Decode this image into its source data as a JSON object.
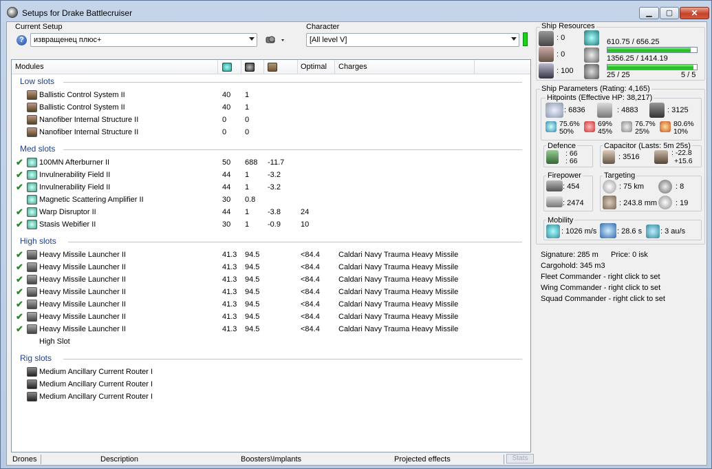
{
  "window": {
    "title": "Setups for Drake Battlecruiser"
  },
  "setup": {
    "label": "Current Setup",
    "value": "извращенец плюс+"
  },
  "character": {
    "label": "Character",
    "value": "[All level V]"
  },
  "modules": {
    "columns": {
      "modules": "Modules",
      "optimal": "Optimal",
      "charges": "Charges"
    },
    "sections": [
      {
        "title": "Low slots",
        "rows": [
          {
            "name": "Ballistic Control System II",
            "v1": "40",
            "v2": "1",
            "v3": "",
            "opt": "",
            "charges": "",
            "active": false
          },
          {
            "name": "Ballistic Control System II",
            "v1": "40",
            "v2": "1",
            "v3": "",
            "opt": "",
            "charges": "",
            "active": false
          },
          {
            "name": "Nanofiber Internal Structure II",
            "v1": "0",
            "v2": "0",
            "v3": "",
            "opt": "",
            "charges": "",
            "active": false
          },
          {
            "name": "Nanofiber Internal Structure II",
            "v1": "0",
            "v2": "0",
            "v3": "",
            "opt": "",
            "charges": "",
            "active": false
          }
        ]
      },
      {
        "title": "Med slots",
        "rows": [
          {
            "name": "100MN Afterburner II",
            "v1": "50",
            "v2": "688",
            "v3": "-11.7",
            "opt": "",
            "charges": "",
            "active": true
          },
          {
            "name": "Invulnerability Field II",
            "v1": "44",
            "v2": "1",
            "v3": "-3.2",
            "opt": "",
            "charges": "",
            "active": true
          },
          {
            "name": "Invulnerability Field II",
            "v1": "44",
            "v2": "1",
            "v3": "-3.2",
            "opt": "",
            "charges": "",
            "active": true
          },
          {
            "name": "Magnetic Scattering Amplifier II",
            "v1": "30",
            "v2": "0.8",
            "v3": "",
            "opt": "",
            "charges": "",
            "active": false
          },
          {
            "name": "Warp Disruptor II",
            "v1": "44",
            "v2": "1",
            "v3": "-3.8",
            "opt": "24",
            "charges": "",
            "active": true
          },
          {
            "name": "Stasis Webifier II",
            "v1": "30",
            "v2": "1",
            "v3": "-0.9",
            "opt": "10",
            "charges": "",
            "active": true
          }
        ]
      },
      {
        "title": "High slots",
        "rows": [
          {
            "name": "Heavy Missile Launcher II",
            "v1": "41.3",
            "v2": "94.5",
            "v3": "",
            "opt": "<84.4",
            "charges": "Caldari Navy Trauma Heavy Missile",
            "active": true
          },
          {
            "name": "Heavy Missile Launcher II",
            "v1": "41.3",
            "v2": "94.5",
            "v3": "",
            "opt": "<84.4",
            "charges": "Caldari Navy Trauma Heavy Missile",
            "active": true
          },
          {
            "name": "Heavy Missile Launcher II",
            "v1": "41.3",
            "v2": "94.5",
            "v3": "",
            "opt": "<84.4",
            "charges": "Caldari Navy Trauma Heavy Missile",
            "active": true
          },
          {
            "name": "Heavy Missile Launcher II",
            "v1": "41.3",
            "v2": "94.5",
            "v3": "",
            "opt": "<84.4",
            "charges": "Caldari Navy Trauma Heavy Missile",
            "active": true
          },
          {
            "name": "Heavy Missile Launcher II",
            "v1": "41.3",
            "v2": "94.5",
            "v3": "",
            "opt": "<84.4",
            "charges": "Caldari Navy Trauma Heavy Missile",
            "active": true
          },
          {
            "name": "Heavy Missile Launcher II",
            "v1": "41.3",
            "v2": "94.5",
            "v3": "",
            "opt": "<84.4",
            "charges": "Caldari Navy Trauma Heavy Missile",
            "active": true
          },
          {
            "name": "Heavy Missile Launcher II",
            "v1": "41.3",
            "v2": "94.5",
            "v3": "",
            "opt": "<84.4",
            "charges": "Caldari Navy Trauma Heavy Missile",
            "active": true
          },
          {
            "name": "High Slot",
            "v1": "",
            "v2": "",
            "v3": "",
            "opt": "",
            "charges": "",
            "active": false
          }
        ]
      },
      {
        "title": "Rig slots",
        "rows": [
          {
            "name": "Medium Ancillary Current Router I",
            "v1": "",
            "v2": "",
            "v3": "",
            "opt": "",
            "charges": "",
            "active": false
          },
          {
            "name": "Medium Ancillary Current Router I",
            "v1": "",
            "v2": "",
            "v3": "",
            "opt": "",
            "charges": "",
            "active": false
          },
          {
            "name": "Medium Ancillary Current Router I",
            "v1": "",
            "v2": "",
            "v3": "",
            "opt": "",
            "charges": "",
            "active": false
          }
        ]
      }
    ]
  },
  "bottom_tabs": [
    "Drones",
    "Description",
    "Boosters\\Implants",
    "Projected effects"
  ],
  "stats_button": "Stats",
  "resources": {
    "title": "Ship Resources",
    "turrets": ": 0",
    "launchers": ": 0",
    "calibration": ": 100",
    "cpu": "610.75 / 656.25",
    "cpu_fraction": 0.93,
    "power": "1356.25 / 1414.19",
    "power_fraction": 0.96,
    "drones": "25 / 25",
    "drones_active": "5 / 5"
  },
  "params": {
    "title": "Ship Parameters (Rating: 4,165)",
    "hitpoints": "Hitpoints (Effective HP: 38,217)",
    "shield_hp": ": 6836",
    "armor_hp": ": 4883",
    "hull_hp": ": 3125",
    "res": [
      [
        "75.6%",
        "50%"
      ],
      [
        "69%",
        "45%"
      ],
      [
        "76.7%",
        "25%"
      ],
      [
        "80.6%",
        "10%"
      ]
    ],
    "defence": "Defence",
    "def1": ": 66",
    "def2": ": 66",
    "capacitor": "Capacitor (Lasts: 5m 25s)",
    "cap_amount": ": 3516",
    "cap_d1": ": -22.8",
    "cap_d2": "+15.6",
    "firepower": "Firepower",
    "volley": ": 454",
    "dps": ": 2474",
    "targeting": "Targeting",
    "range": ": 75 km",
    "max_targets": ": 8",
    "scan_res": ": 243.8 mm",
    "sensor": ": 19",
    "mobility": "Mobility",
    "speed": ": 1026 m/s",
    "align": ": 28.6 s",
    "warp": ": 3 au/s",
    "signature": "Signature: 285 m",
    "price": "Price: 0 isk",
    "cargo": "Cargohold: 345 m3",
    "fleet": "Fleet Commander - right click to set",
    "wing": "Wing Commander - right click to set",
    "squad": "Squad Commander - right click to set"
  }
}
